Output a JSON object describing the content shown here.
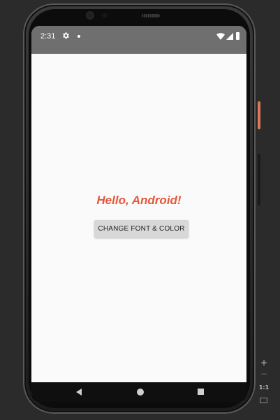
{
  "status_bar": {
    "time": "2:31",
    "icons": [
      "gear-icon",
      "notification-dot-icon",
      "wifi-icon",
      "signal-icon",
      "battery-icon"
    ]
  },
  "app": {
    "hello_text": "Hello, Android!",
    "change_button_label": "CHANGE FONT & COLOR",
    "hello_color": "#e4573a",
    "background_color": "#fafafa"
  },
  "nav_bar": {
    "icons": [
      "back-icon",
      "home-icon",
      "recents-icon"
    ]
  },
  "emulator_controls": {
    "zoom_in": "+",
    "zoom_out": "−",
    "actual_size": "1:1",
    "icons": [
      "zoom-in-icon",
      "zoom-out-icon",
      "actual-size-icon",
      "fit-screen-icon"
    ]
  },
  "colors": {
    "status_bar": "#6f6f6f",
    "device_frame": "#1c1c1c",
    "power_button": "#e0765a",
    "emulator_background": "#2b2b2b"
  }
}
